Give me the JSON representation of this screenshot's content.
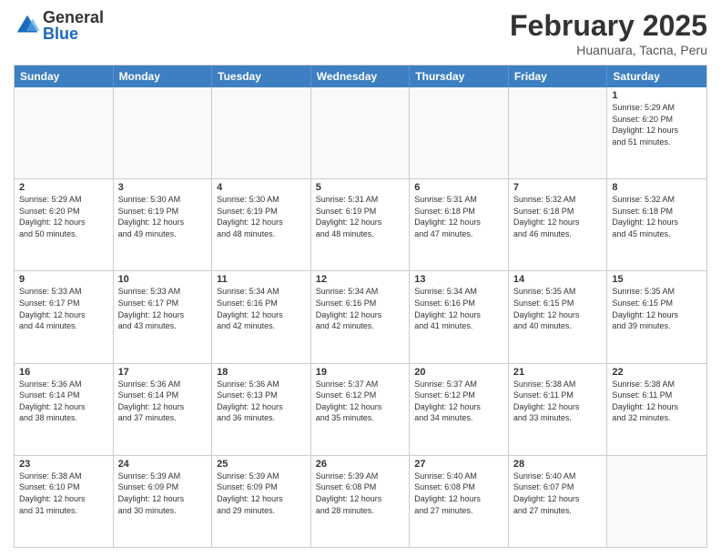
{
  "header": {
    "logo_general": "General",
    "logo_blue": "Blue",
    "month_title": "February 2025",
    "location": "Huanuara, Tacna, Peru"
  },
  "weekdays": [
    "Sunday",
    "Monday",
    "Tuesday",
    "Wednesday",
    "Thursday",
    "Friday",
    "Saturday"
  ],
  "rows": [
    [
      {
        "day": "",
        "info": ""
      },
      {
        "day": "",
        "info": ""
      },
      {
        "day": "",
        "info": ""
      },
      {
        "day": "",
        "info": ""
      },
      {
        "day": "",
        "info": ""
      },
      {
        "day": "",
        "info": ""
      },
      {
        "day": "1",
        "info": "Sunrise: 5:29 AM\nSunset: 6:20 PM\nDaylight: 12 hours\nand 51 minutes."
      }
    ],
    [
      {
        "day": "2",
        "info": "Sunrise: 5:29 AM\nSunset: 6:20 PM\nDaylight: 12 hours\nand 50 minutes."
      },
      {
        "day": "3",
        "info": "Sunrise: 5:30 AM\nSunset: 6:19 PM\nDaylight: 12 hours\nand 49 minutes."
      },
      {
        "day": "4",
        "info": "Sunrise: 5:30 AM\nSunset: 6:19 PM\nDaylight: 12 hours\nand 48 minutes."
      },
      {
        "day": "5",
        "info": "Sunrise: 5:31 AM\nSunset: 6:19 PM\nDaylight: 12 hours\nand 48 minutes."
      },
      {
        "day": "6",
        "info": "Sunrise: 5:31 AM\nSunset: 6:18 PM\nDaylight: 12 hours\nand 47 minutes."
      },
      {
        "day": "7",
        "info": "Sunrise: 5:32 AM\nSunset: 6:18 PM\nDaylight: 12 hours\nand 46 minutes."
      },
      {
        "day": "8",
        "info": "Sunrise: 5:32 AM\nSunset: 6:18 PM\nDaylight: 12 hours\nand 45 minutes."
      }
    ],
    [
      {
        "day": "9",
        "info": "Sunrise: 5:33 AM\nSunset: 6:17 PM\nDaylight: 12 hours\nand 44 minutes."
      },
      {
        "day": "10",
        "info": "Sunrise: 5:33 AM\nSunset: 6:17 PM\nDaylight: 12 hours\nand 43 minutes."
      },
      {
        "day": "11",
        "info": "Sunrise: 5:34 AM\nSunset: 6:16 PM\nDaylight: 12 hours\nand 42 minutes."
      },
      {
        "day": "12",
        "info": "Sunrise: 5:34 AM\nSunset: 6:16 PM\nDaylight: 12 hours\nand 42 minutes."
      },
      {
        "day": "13",
        "info": "Sunrise: 5:34 AM\nSunset: 6:16 PM\nDaylight: 12 hours\nand 41 minutes."
      },
      {
        "day": "14",
        "info": "Sunrise: 5:35 AM\nSunset: 6:15 PM\nDaylight: 12 hours\nand 40 minutes."
      },
      {
        "day": "15",
        "info": "Sunrise: 5:35 AM\nSunset: 6:15 PM\nDaylight: 12 hours\nand 39 minutes."
      }
    ],
    [
      {
        "day": "16",
        "info": "Sunrise: 5:36 AM\nSunset: 6:14 PM\nDaylight: 12 hours\nand 38 minutes."
      },
      {
        "day": "17",
        "info": "Sunrise: 5:36 AM\nSunset: 6:14 PM\nDaylight: 12 hours\nand 37 minutes."
      },
      {
        "day": "18",
        "info": "Sunrise: 5:36 AM\nSunset: 6:13 PM\nDaylight: 12 hours\nand 36 minutes."
      },
      {
        "day": "19",
        "info": "Sunrise: 5:37 AM\nSunset: 6:12 PM\nDaylight: 12 hours\nand 35 minutes."
      },
      {
        "day": "20",
        "info": "Sunrise: 5:37 AM\nSunset: 6:12 PM\nDaylight: 12 hours\nand 34 minutes."
      },
      {
        "day": "21",
        "info": "Sunrise: 5:38 AM\nSunset: 6:11 PM\nDaylight: 12 hours\nand 33 minutes."
      },
      {
        "day": "22",
        "info": "Sunrise: 5:38 AM\nSunset: 6:11 PM\nDaylight: 12 hours\nand 32 minutes."
      }
    ],
    [
      {
        "day": "23",
        "info": "Sunrise: 5:38 AM\nSunset: 6:10 PM\nDaylight: 12 hours\nand 31 minutes."
      },
      {
        "day": "24",
        "info": "Sunrise: 5:39 AM\nSunset: 6:09 PM\nDaylight: 12 hours\nand 30 minutes."
      },
      {
        "day": "25",
        "info": "Sunrise: 5:39 AM\nSunset: 6:09 PM\nDaylight: 12 hours\nand 29 minutes."
      },
      {
        "day": "26",
        "info": "Sunrise: 5:39 AM\nSunset: 6:08 PM\nDaylight: 12 hours\nand 28 minutes."
      },
      {
        "day": "27",
        "info": "Sunrise: 5:40 AM\nSunset: 6:08 PM\nDaylight: 12 hours\nand 27 minutes."
      },
      {
        "day": "28",
        "info": "Sunrise: 5:40 AM\nSunset: 6:07 PM\nDaylight: 12 hours\nand 27 minutes."
      },
      {
        "day": "",
        "info": ""
      }
    ]
  ]
}
